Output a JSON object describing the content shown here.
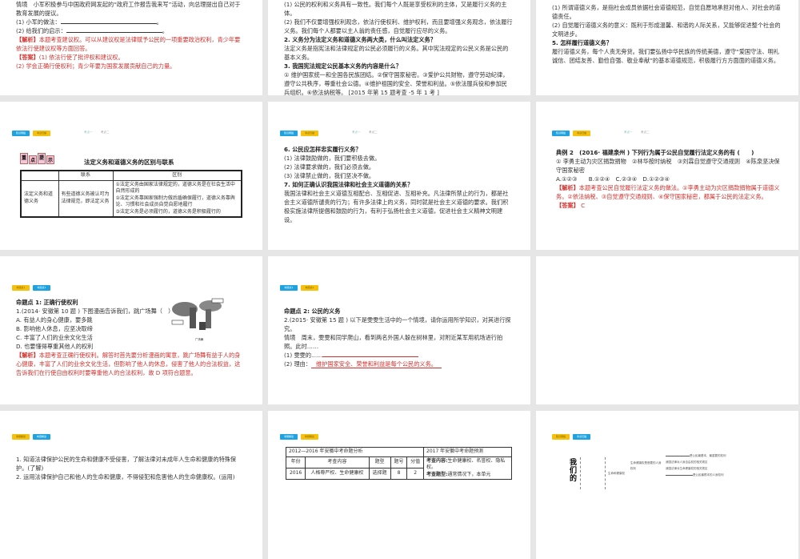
{
  "tags": {
    "zhishi": "知识网络",
    "kaodian": "考点扫描",
    "mingti1": "命题点1",
    "mingti2": "命题点2",
    "kaogang": "考纲解读",
    "mingtijiedu": "命题解读"
  },
  "tabs": [
    "考点一",
    "考点二"
  ],
  "s1": {
    "lines": [
      "情境　小军积极参与中国政府网发起的“政府工作报告我来写”活动，向总理提出自己对于教育发展的提议。",
      "(1) 小军的做法：",
      "(2) 给我们的启示："
    ],
    "period": "。",
    "jiexi_label": "【解析】",
    "jiexi": "本题考查建议权。可以从建议权是法律赋予公民的一项重要政治权利，青少年要依法行使建议权等方面回答。",
    "daan_label": "【答案】",
    "daan1": "(1) 依法行使了批评权和建议权。",
    "daan2": "(2) 学会正确行使权利；青少年要为国家发展贡献自己的力量。"
  },
  "s2": {
    "lines": [
      "(1) 公民的权利和义务具有一致性。我们每个人既是享受权利的主体，又是履行义务的主体。",
      "(2) 我们不仅要增强权利观念，依法行使权利、维护权利，而且要增强义务观念，依法履行义务。我们每个人都要以主人翁的责任感，自觉履行应尽的义务。"
    ],
    "q2": "2. 义务分为法定义务和道德义务两大类，什么叫法定义务？",
    "a2": "法定义务是指宪法和法律规定的公民必须履行的义务。其中宪法规定的公民义务是公民的基本义务。",
    "q3": "3. 我国宪法规定公民基本义务的内容是什么？",
    "a3": "① 维护国家统一和全国各民族团结。②保守国家秘密。③爱护公共财物，遵守劳动纪律，遵守公共秩序，尊重社会公德。④维护祖国的安全、荣誉和利益。⑤依法服兵役和参加民兵组织。⑥依法纳税等。 [2015 年第 15 题考查 -5 年 1 考 ]"
  },
  "s3": {
    "lines": [
      "(1) 所谓道德义务，是指社会成员依据社会道德规范，自觉自愿地承担对他人、对社会的道德责任。",
      "(2) 自觉履行道德义务的意义：既利于形成温馨、和谐的人际关系，又能够促进整个社会的文明进步。"
    ],
    "q5": "5. 怎样履行道德义务？",
    "a5": "履行道德义务，每个人责无旁贷。我们要弘扬中华民族的传统美德，遵守“爱国守法、明礼诚信、团结友善、勤俭自强、敬业奉献”的基本道德规范，积极履行方方面面的道德义务。"
  },
  "s4": {
    "badge": [
      "重",
      "点",
      "提",
      "示"
    ],
    "title": "法定义务和道德义务的区别与联系",
    "h_lianxi": "联系",
    "h_qubie": "区别",
    "row_label": "法定义务和道德义务",
    "lianxi": "有些道德义务被认可为法律规范，即法定义务",
    "qubie": [
      "①法定义务由国家法律规定的，道德义务是在社会生活中自然形成的",
      "②法定义务靠国家强制力做后盾确保履行，道德义务靠舆论、习惯和社会成员自觉自愿地履行",
      "③法定义务是必须履行的，道德义务是积极履行的"
    ]
  },
  "s5": {
    "q6": "6. 公民应怎样忠实履行义务？",
    "a6": [
      "(1) 法律鼓励做的，我们要积极去做。",
      "(2) 法律要求做的，我们必须去做。",
      "(3) 法律禁止做的，我们坚决不做。"
    ],
    "q7": "7. 如何正确认识我国法律和社会主义道德的关系？",
    "a7": "我国法律和社会主义道德互相配合、互相促进、互相补充。凡法律所禁止的行为，都是社会主义道德所谴责的行为；有许多法律上的义务，同时就是社会主义道德的要求。我们积极实施法律所提倡和鼓励的行为，有利于弘扬社会主义道德，促进社会主义精神文明建设。"
  },
  "s6": {
    "title": "典例 2　(2016· 福建泉州 ) 下列行为属于公民自觉履行法定义务的有 (　　)",
    "opts": "① 李勇主动为灾区捐款捐物　②林华按时纳税　③刘霖自觉遵守交通规则　④陈泉坚决保守国家秘密",
    "choices": "A.①②③　　B.①②④　C.②③④　D.①②③④",
    "jiexi_label": "【解析】",
    "jiexi": "本题考查公民自觉履行法定义务的做法。①李勇主动为灾区捐款捐物属于道德义务。②依法纳税、③自觉遵守交通规则、④保守国家秘密，都属于公民的法定义务。",
    "daan_label": "【答案】",
    "daan": "C"
  },
  "s7": {
    "title": "命题点 1: 正确行使权利",
    "q": "1.(2014· 安徽第 10 题 ) 下图漫画告诉我们，跳广场舞（　）",
    "ans": "D",
    "opts": [
      "A. 有益人的身心健康，要多跳",
      "B. 影响他人休息，应坚决取缔",
      "C. 丰富了人们的业余文化生活",
      "D. 也要懂得尊重其他人的权利"
    ],
    "cartoon_caption": "广场舞",
    "jiexi_label": "【解析】",
    "jiexi": "本题考查正确行使权利。解答时首先要分析漫画的寓意，跳广场舞有益于人的身心健康，丰富了人们的业余文化生活，但影响了他人的休息，侵害了他人的合法权益，这告诉我们在行使自由权利时要尊重他人的合法权利，故 D 项符合题意。"
  },
  "s8": {
    "title": "命题点 2: 公民的义务",
    "q": "2.(2015· 安徽第 15 题 ) 以下是雯雯生活中的一个情境，请你运用所学知识，对其进行探究。",
    "qj": "情境　周末，雯雯和同学爬山，看到两名外国人躲在树林里，对附近某军用机场进行拍照。此时……",
    "l1": "(1) 雯雯的……",
    "l2": "(2) 理由：",
    "a2": "维护国家安全、荣誉和利益是每个公民的义务。"
  },
  "s10": {
    "lines": [
      "1. 知道法律保护公民的生命和健康不受侵害，了解法律对未成年人生命和健康的特殊保护。(了解)",
      "2. 运用法律保护自己和他人的生命和健康，不得侵犯和危害他人的生命健康权。(运用)"
    ]
  },
  "s11": {
    "h_left": "2012—2016 年安徽中考命题分析",
    "h_right": "2017 年安徽中考命题预测",
    "cols": [
      "年份",
      "考查内容",
      "题型",
      "题号",
      "分值"
    ],
    "row": [
      "2016",
      "人格尊严权、生命健康权",
      "选择题",
      "8",
      "2"
    ],
    "pred1_label": "考查内容:",
    "pred1": "生命健康权、名誉权、隐私权。",
    "pred2_label": "考查题型:",
    "pred2": "通常情况下，本单元"
  },
  "s12": {
    "title": "我们的",
    "n1": "生命健康权是首要的人身权利",
    "n2": "生命和健康权",
    "r1": "是公民最基本、最重要的权利",
    "r2": "我国法律对人身自由权的相关规定",
    "r3": "我国法律对生命健康权的相关规定",
    "r4": "是公民最根本的人身权利"
  }
}
